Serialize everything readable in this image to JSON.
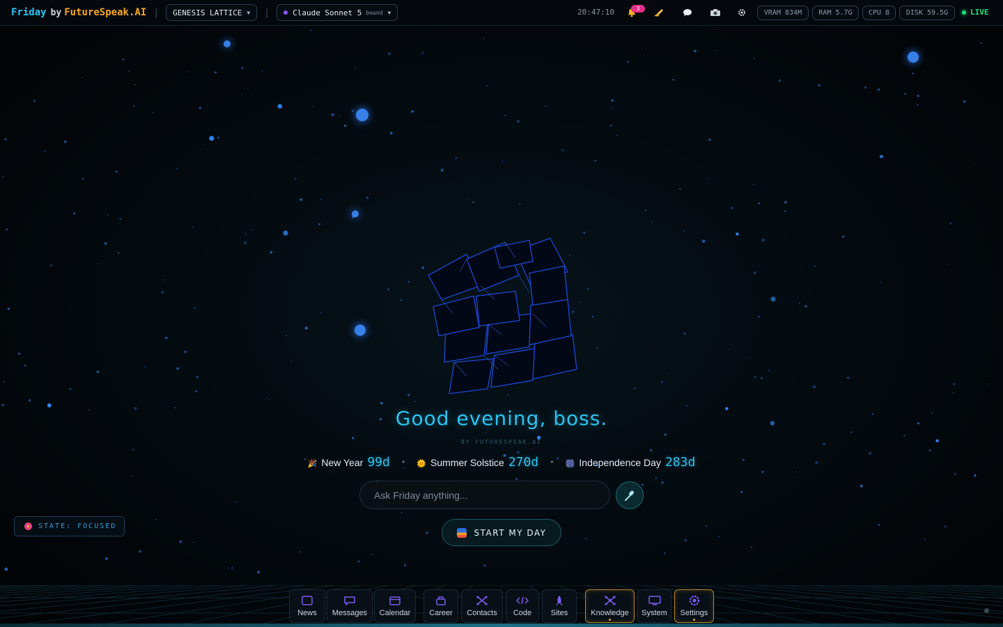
{
  "brand": {
    "name": "Friday",
    "by": "by",
    "company": "FutureSpeak.AI"
  },
  "topbar": {
    "separator": "|",
    "workspace": "GENESIS LATTICE",
    "model": {
      "name": "Claude Sonnet 5",
      "tag": "bound"
    },
    "clock": "20:47:10",
    "notification_count": "3",
    "icons": [
      "bell-icon",
      "hand-writing-icon",
      "chat-bubble-icon",
      "camera-icon",
      "gear-icon"
    ],
    "stats": {
      "vram": "VRAM 834M",
      "ram": "RAM 5.7G",
      "cpu": "CPU 8",
      "disk": "DISK 59.5G"
    },
    "live": "LIVE"
  },
  "main": {
    "greeting": "Good evening, boss.",
    "byline": "BY FUTURESPEAK.AI",
    "countdowns": [
      {
        "icon": "🎉",
        "label": "New Year",
        "value": "99d"
      },
      {
        "icon": "🌞",
        "label": "Summer Solstice",
        "value": "270d"
      },
      {
        "icon": "🎆",
        "label": "Independence Day",
        "value": "283d"
      }
    ],
    "countdown_separator": "•",
    "ask_placeholder": "Ask Friday anything...",
    "start_button": "START MY DAY"
  },
  "state": {
    "label": "STATE: FOCUSED"
  },
  "dock": {
    "items": [
      {
        "label": "News",
        "icon": "newspaper-icon"
      },
      {
        "label": "Messages",
        "icon": "message-icon"
      },
      {
        "label": "Calendar",
        "icon": "calendar-icon"
      },
      {
        "label": "Career",
        "icon": "briefcase-icon"
      },
      {
        "label": "Contacts",
        "icon": "network-icon"
      },
      {
        "label": "Code",
        "icon": "code-icon"
      },
      {
        "label": "Sites",
        "icon": "rocket-icon"
      },
      {
        "label": "Knowledge",
        "icon": "graph-icon",
        "active": true
      },
      {
        "label": "System",
        "icon": "monitor-icon"
      },
      {
        "label": "Settings",
        "icon": "settings-icon",
        "active": true
      }
    ]
  },
  "colors": {
    "accent": "#2dc3ef",
    "brand_orange": "#f5a623",
    "live_green": "#1fe07d",
    "badge_pink": "#e52d8a",
    "active_border": "#b98a2a"
  }
}
